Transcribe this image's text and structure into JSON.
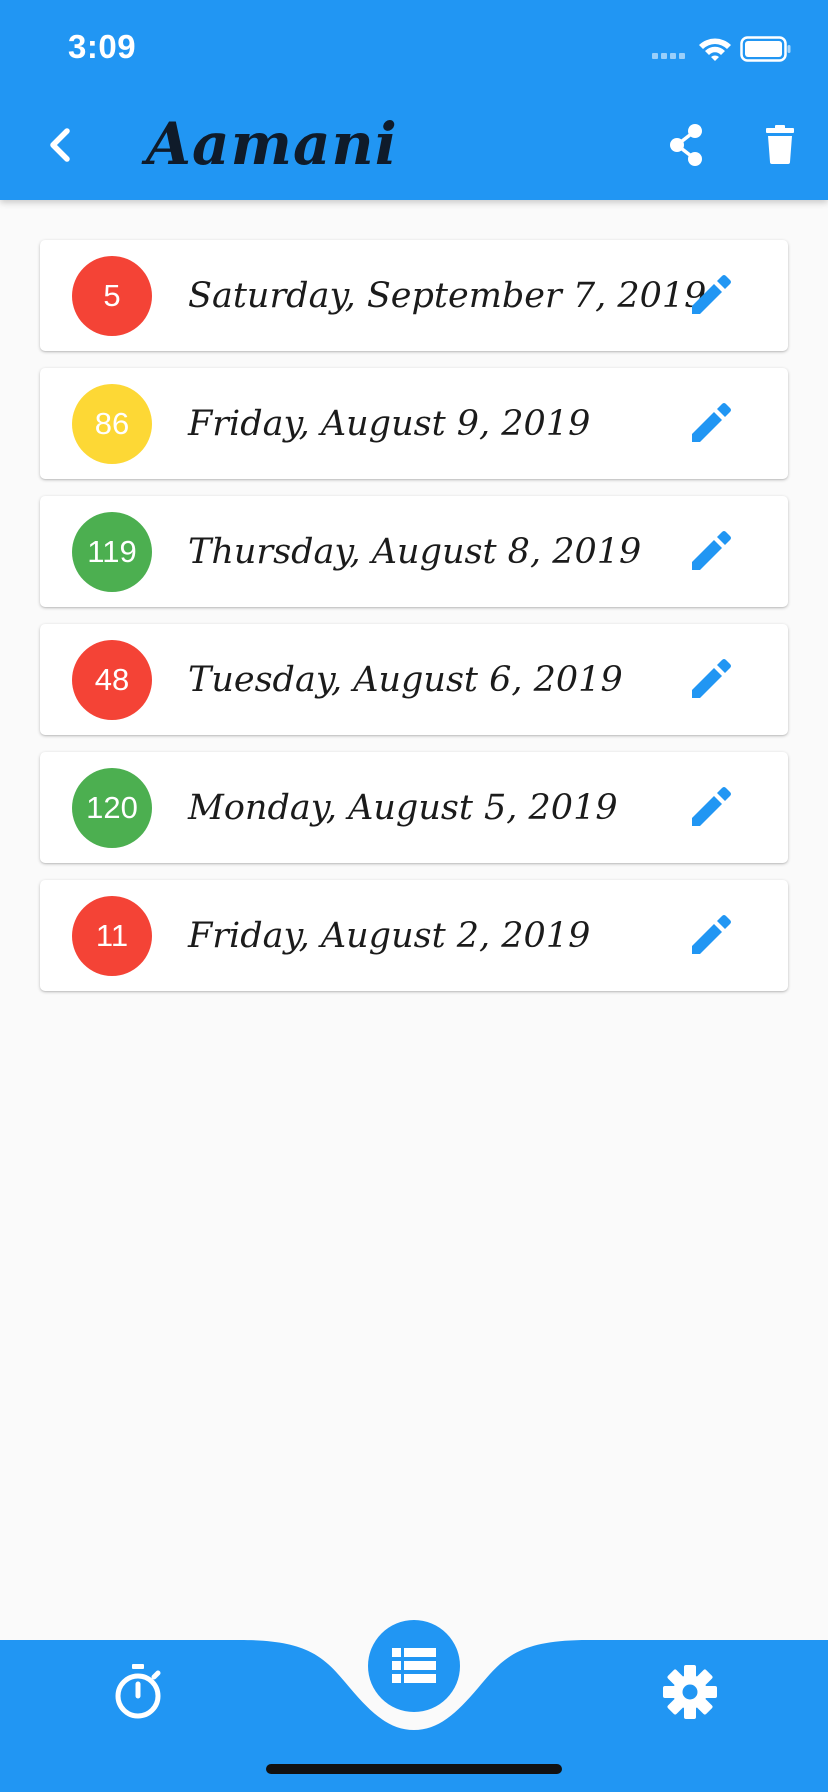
{
  "status_bar": {
    "time": "3:09"
  },
  "app_bar": {
    "title": "Aamani",
    "color": "#2196f3",
    "icons": [
      "back-icon",
      "share-icon",
      "delete-icon"
    ]
  },
  "entries": [
    {
      "value": "5",
      "date": "Saturday, September 7, 2019",
      "color": "#f44336"
    },
    {
      "value": "86",
      "date": "Friday, August 9, 2019",
      "color": "#fdd835"
    },
    {
      "value": "119",
      "date": "Thursday, August 8, 2019",
      "color": "#4caf50"
    },
    {
      "value": "48",
      "date": "Tuesday, August 6, 2019",
      "color": "#f44336"
    },
    {
      "value": "120",
      "date": "Monday, August 5, 2019",
      "color": "#4caf50"
    },
    {
      "value": "11",
      "date": "Friday, August 2, 2019",
      "color": "#f44336"
    }
  ],
  "bottom_nav": {
    "icons": [
      "timer-icon",
      "list-icon",
      "settings-icon"
    ],
    "active": "list-icon"
  }
}
